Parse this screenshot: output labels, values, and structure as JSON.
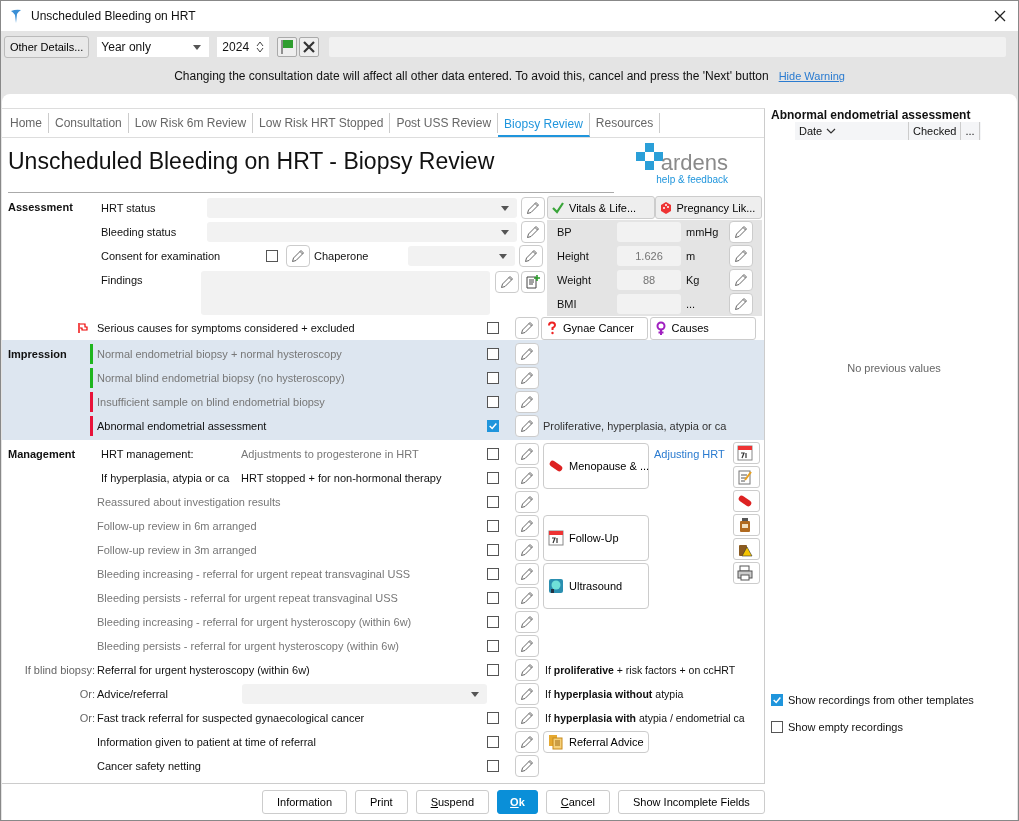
{
  "window": {
    "title": "Unscheduled Bleeding on HRT"
  },
  "toolbar": {
    "other_details": "Other Details...",
    "date_precision": "Year only",
    "year": "2024",
    "warning": "Changing the consultation date will affect all other data entered. To avoid this, cancel and press the 'Next' button",
    "hide_warning": "Hide Warning"
  },
  "tabs": [
    {
      "label": "Home",
      "selected": false
    },
    {
      "label": "Consultation",
      "selected": false
    },
    {
      "label": "Low Risk 6m Review",
      "selected": false
    },
    {
      "label": "Low Risk HRT Stopped",
      "selected": false
    },
    {
      "label": "Post USS Review",
      "selected": false
    },
    {
      "label": "Biopsy Review",
      "selected": true
    },
    {
      "label": "Resources",
      "selected": false
    }
  ],
  "heading": "Unscheduled Bleeding on HRT - Biopsy Review",
  "logo": {
    "name": "ardens",
    "link": "help & feedback"
  },
  "assessment": {
    "label": "Assessment",
    "rows": [
      {
        "kind": "dropdown",
        "label": "HRT status"
      },
      {
        "kind": "dropdown",
        "label": "Bleeding status"
      },
      {
        "kind": "consent",
        "label": "Consent for examination",
        "checked": false,
        "second_label": "Chaperone"
      },
      {
        "kind": "textarea",
        "label": "Findings"
      }
    ],
    "vitals": {
      "buttons": [
        "Vitals & Life...",
        "Pregnancy Lik..."
      ],
      "fields": [
        {
          "label": "BP",
          "unit": "mmHg"
        },
        {
          "label": "Height",
          "placeholder": "1.626",
          "unit": "m"
        },
        {
          "label": "Weight",
          "placeholder": "88",
          "unit": "Kg"
        },
        {
          "label": "BMI",
          "unit": "..."
        }
      ]
    },
    "serious": {
      "label": "Serious causes for symptoms considered + excluded",
      "checked": false,
      "flagged": true,
      "buttons": [
        "Gynae Cancer",
        "Causes"
      ]
    }
  },
  "impression": {
    "label": "Impression",
    "rows": [
      {
        "label": "Normal endometrial biopsy + normal hysteroscopy",
        "color": "#1fb51f",
        "checked": false
      },
      {
        "label": "Normal blind endometrial biopsy (no hysteroscopy)",
        "color": "#1fb51f",
        "checked": false
      },
      {
        "label": "Insufficient sample on blind endometrial biopsy",
        "color": "#e8133a",
        "checked": false
      },
      {
        "label": "Abnormal endometrial assessment",
        "color": "#e8133a",
        "checked": true,
        "note": "Proliferative, hyperplasia, atypia or ca"
      }
    ]
  },
  "management": {
    "label": "Management",
    "rows": [
      {
        "kind": "check",
        "prefix": "HRT management:",
        "label": "Adjustments to progesterone in HRT",
        "dimmed": true,
        "checked": false
      },
      {
        "kind": "check",
        "prefix": "If hyperplasia, atypia or ca",
        "label": "HRT stopped + for non-hormonal therapy",
        "dimmed": false,
        "checked": false
      },
      {
        "kind": "check",
        "label": "Reassured about investigation results",
        "dimmed": true,
        "checked": false
      },
      {
        "kind": "check",
        "label": "Follow-up review in 6m arranged",
        "dimmed": true,
        "checked": false
      },
      {
        "kind": "check",
        "label": "Follow-up review in 3m arranged",
        "dimmed": true,
        "checked": false
      },
      {
        "kind": "check",
        "label": "Bleeding increasing - referral for urgent repeat transvaginal USS",
        "dimmed": true,
        "checked": false
      },
      {
        "kind": "check",
        "label": "Bleeding persists - referral for urgent repeat transvaginal USS",
        "dimmed": true,
        "checked": false
      },
      {
        "kind": "check",
        "label": "Bleeding increasing - referral for urgent hysteroscopy (within 6w)",
        "dimmed": true,
        "checked": false
      },
      {
        "kind": "check",
        "label": "Bleeding persists - referral for urgent hysteroscopy (within 6w)",
        "dimmed": true,
        "checked": false
      },
      {
        "kind": "check",
        "lead": "If blind biopsy:",
        "label": "Referral for urgent hysteroscopy (within 6w)",
        "dimmed": false,
        "checked": false,
        "note": "If **proliferative** + risk factors + on ccHRT"
      },
      {
        "kind": "dropdown",
        "lead": "Or:",
        "label": "Advice/referral",
        "dimmed": false,
        "note": "If **hyperplasia without** atypia"
      },
      {
        "kind": "check",
        "lead": "Or:",
        "label": "Fast track referral for suspected gynaecological cancer",
        "dimmed": false,
        "checked": false,
        "note": "If **hyperplasia with** atypia / endometrial ca"
      },
      {
        "kind": "check",
        "label": "Information given to patient at time of referral",
        "dimmed": false,
        "checked": false
      },
      {
        "kind": "check",
        "label": "Cancer safety netting",
        "dimmed": false,
        "checked": false
      }
    ],
    "side_buttons": [
      "Menopause & ...",
      "Follow-Up",
      "Ultrasound",
      "Referral Advice"
    ],
    "link": "Adjusting HRT"
  },
  "history": {
    "title": "Abnormal endometrial assessment",
    "columns": [
      {
        "label": "Date",
        "sorted": true
      },
      {
        "label": "Checked",
        "sorted": false
      },
      {
        "label": "...",
        "sorted": false
      }
    ],
    "empty": "No previous values",
    "options": [
      {
        "label": "Show recordings from other templates",
        "checked": true
      },
      {
        "label": "Show empty recordings",
        "checked": false
      }
    ]
  },
  "footer": [
    {
      "label": "Information",
      "primary": false,
      "mnemonic": false
    },
    {
      "label": "Print",
      "primary": false,
      "mnemonic": false
    },
    {
      "label": "Suspend",
      "primary": false,
      "mnemonic": true
    },
    {
      "label": "Ok",
      "primary": true,
      "mnemonic": true
    },
    {
      "label": "Cancel",
      "primary": false,
      "mnemonic": true
    },
    {
      "label": "Show Incomplete Fields",
      "primary": false,
      "mnemonic": false
    }
  ]
}
